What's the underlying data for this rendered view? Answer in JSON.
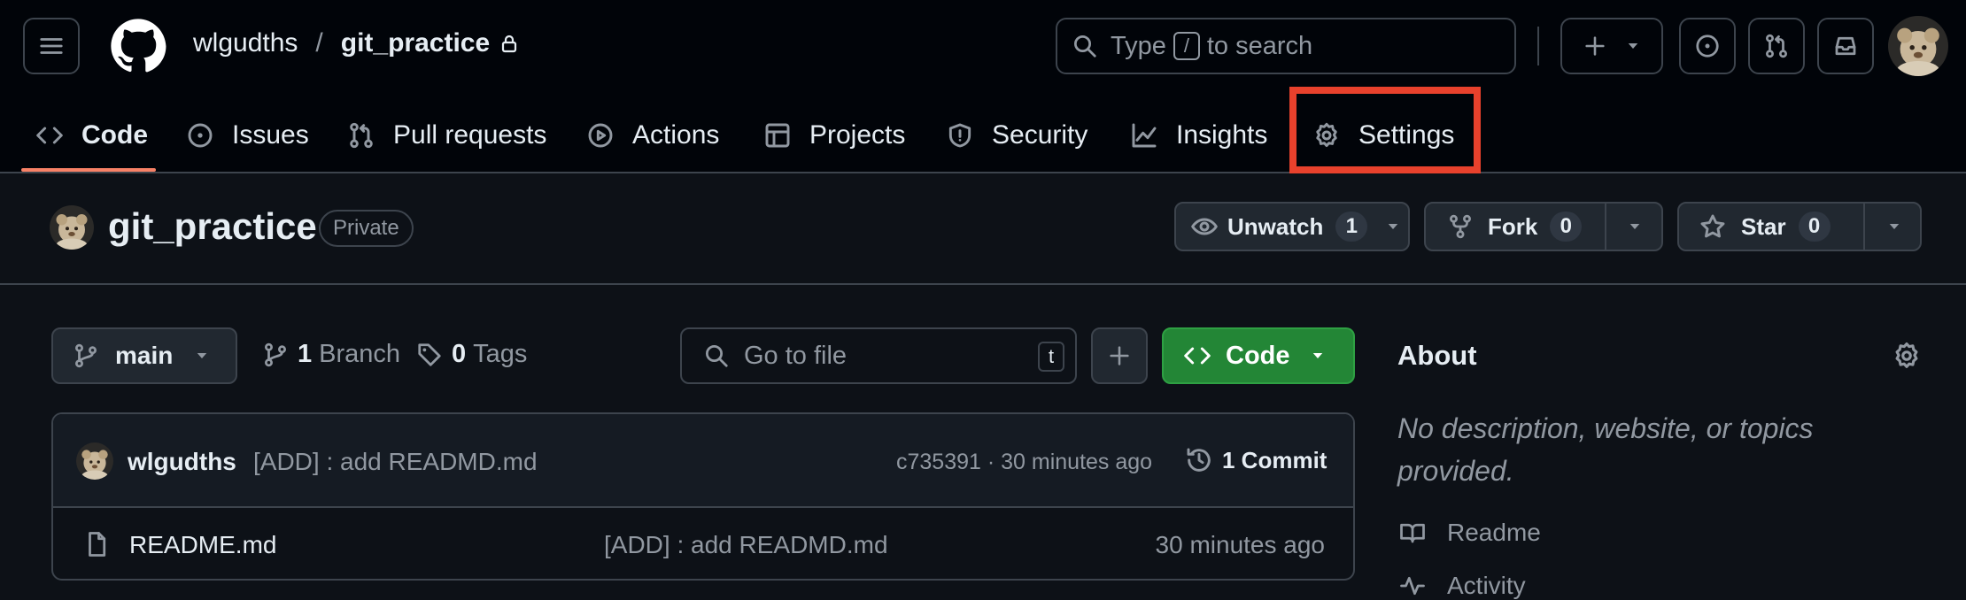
{
  "header": {
    "owner": "wlgudths",
    "separator": "/",
    "repo": "git_practice",
    "search": {
      "type_label": "Type",
      "key": "/",
      "suffix": "to search"
    }
  },
  "nav": {
    "tabs": [
      {
        "label": "Code",
        "active": true
      },
      {
        "label": "Issues"
      },
      {
        "label": "Pull requests"
      },
      {
        "label": "Actions"
      },
      {
        "label": "Projects"
      },
      {
        "label": "Security"
      },
      {
        "label": "Insights"
      },
      {
        "label": "Settings",
        "highlighted": true
      }
    ]
  },
  "repo_header": {
    "name": "git_practice",
    "visibility": "Private",
    "unwatch": {
      "label": "Unwatch",
      "count": "1"
    },
    "fork": {
      "label": "Fork",
      "count": "0"
    },
    "star": {
      "label": "Star",
      "count": "0"
    }
  },
  "toolbar": {
    "branch": "main",
    "branches": {
      "count": "1",
      "label": "Branch"
    },
    "tags": {
      "count": "0",
      "label": "Tags"
    },
    "goto_placeholder": "Go to file",
    "goto_key": "t",
    "code_label": "Code"
  },
  "commit": {
    "author": "wlgudths",
    "message": "[ADD] : add READMD.md",
    "hash_time": "c735391 · 30 minutes ago",
    "commits_label": "1 Commit"
  },
  "files": [
    {
      "name": "README.md",
      "message": "[ADD] : add READMD.md",
      "time": "30 minutes ago"
    }
  ],
  "about": {
    "title": "About",
    "description": "No description, website, or topics provided.",
    "links": [
      {
        "label": "Readme"
      },
      {
        "label": "Activity"
      }
    ]
  },
  "colors": {
    "accent_underline": "#f78166",
    "highlight_box": "#e8412c",
    "code_button": "#238636"
  }
}
